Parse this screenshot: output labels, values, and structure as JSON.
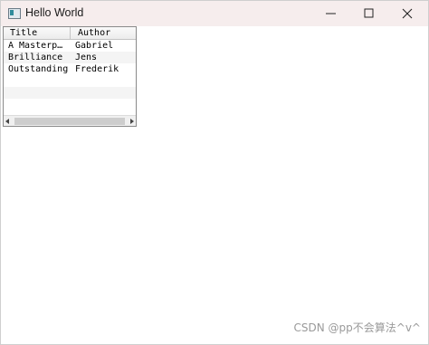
{
  "window": {
    "title": "Hello World",
    "icon": "app-window-icon",
    "controls": [
      "minimize-icon",
      "maximize-icon",
      "close-icon"
    ]
  },
  "table": {
    "columns": [
      "Title",
      "Author"
    ],
    "rows": [
      {
        "title": "A Masterp…",
        "author": "Gabriel"
      },
      {
        "title": "Brilliance",
        "author": "Jens"
      },
      {
        "title": "Outstanding",
        "author": "Frederik"
      }
    ],
    "scroll": {
      "horizontal_thumb_fraction": 0.9
    }
  },
  "watermark": "CSDN @pp不会算法^v^"
}
